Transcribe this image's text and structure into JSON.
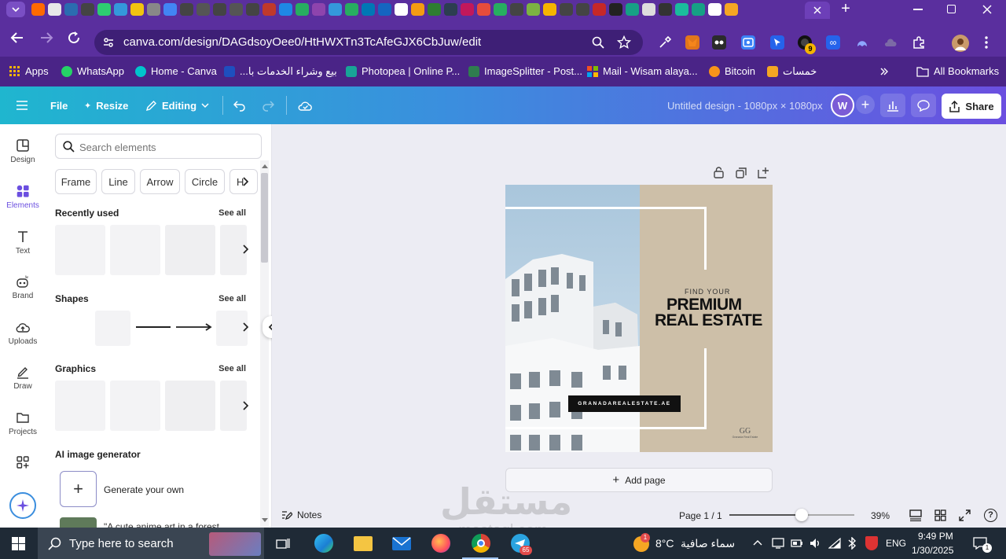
{
  "browser": {
    "url": "canva.com/design/DAGdsoyOee0/HtHWXTn3TcAfeGJX6CbJuw/edit",
    "extension_badge": "9",
    "bookmarks": [
      {
        "label": "Apps"
      },
      {
        "label": "WhatsApp"
      },
      {
        "label": "Home - Canva"
      },
      {
        "label": "بيع وشراء الخدمات با..."
      },
      {
        "label": "Photopea | Online P..."
      },
      {
        "label": "ImageSplitter - Post..."
      },
      {
        "label": "Mail - Wisam alaya..."
      },
      {
        "label": "Bitcoin"
      },
      {
        "label": "خمسات"
      },
      {
        "label": "All Bookmarks"
      }
    ]
  },
  "canva_header": {
    "file": "File",
    "resize": "Resize",
    "editing": "Editing",
    "title": "Untitled design - 1080px × 1080px",
    "avatar": "W",
    "share": "Share"
  },
  "rail": [
    {
      "label": "Design"
    },
    {
      "label": "Elements"
    },
    {
      "label": "Text"
    },
    {
      "label": "Brand"
    },
    {
      "label": "Uploads"
    },
    {
      "label": "Draw"
    },
    {
      "label": "Projects"
    }
  ],
  "panel": {
    "search_placeholder": "Search elements",
    "chips": [
      "Frame",
      "Line",
      "Arrow",
      "Circle",
      "H"
    ],
    "recently_used": "Recently used",
    "shapes": "Shapes",
    "graphics": "Graphics",
    "see_all": "See all",
    "ai_title": "AI image generator",
    "generate": "Generate your own",
    "ai_sample": "\"A cute anime art in a forest"
  },
  "design": {
    "find_your": "FIND YOUR",
    "premium": "PREMIUM",
    "real_estate": "REAL ESTATE",
    "website": "GRANADAREALESTATE.AE",
    "logo_letters": "GG",
    "logo_caption": "Granada Real Estate",
    "add_page": "Add page"
  },
  "footer": {
    "notes": "Notes",
    "page": "Page 1 / 1",
    "zoom": "39%",
    "zoom_level_percent": 39
  },
  "watermark": {
    "arabic": "مستقل",
    "latin": "mostaql.com"
  },
  "taskbar": {
    "search": "Type here to search",
    "temp": "8°C",
    "weather": "سماء صافية",
    "lang": "ENG",
    "time": "9:49 PM",
    "date": "1/30/2025",
    "weather_badge": "1",
    "telegram_badge": "65",
    "notif_badge": "1"
  },
  "colors": {
    "browser_purple": "#5a2f9e",
    "canva_teal": "#1fb6cf",
    "canva_violet": "#6b4fe0",
    "design_beige": "#cdbfa8"
  }
}
